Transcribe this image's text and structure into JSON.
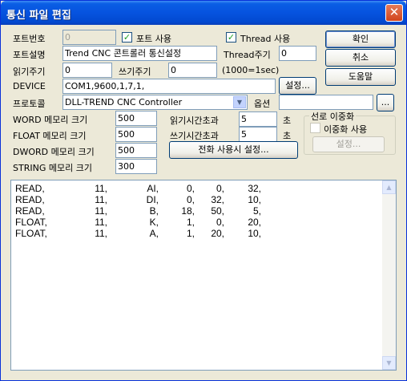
{
  "window": {
    "title": "통신 파일 편집",
    "close_glyph": "✕"
  },
  "form": {
    "port_no": {
      "label": "포트번호",
      "value": "0"
    },
    "port_use": {
      "label": "포트 사용",
      "checked": true
    },
    "thread_use": {
      "label": "Thread 사용",
      "checked": true
    },
    "port_desc": {
      "label": "포트설명",
      "value": "Trend CNC 콘트롤러 통신설정"
    },
    "thread_period": {
      "label": "Thread주기",
      "value": "0"
    },
    "read_period": {
      "label": "읽기주기",
      "value": "0"
    },
    "write_period": {
      "label": "쓰기주기",
      "value": "0"
    },
    "period_unit": "(1000=1sec)",
    "device": {
      "label": "DEVICE",
      "value": "COM1,9600,1,7,1,",
      "button": "설정..."
    },
    "protocol": {
      "label": "프로토콜",
      "value": "DLL-TREND CNC Controller",
      "option_label": "옵션",
      "option_value": "",
      "ellipsis_button": "..."
    },
    "word_mem": {
      "label": "WORD 메모리 크기",
      "value": "500"
    },
    "float_mem": {
      "label": "FLOAT 메모리 크기",
      "value": "500"
    },
    "dword_mem": {
      "label": "DWORD 메모리 크기",
      "value": "500"
    },
    "string_mem": {
      "label": "STRING 메모리 크기",
      "value": "300"
    },
    "read_timeout": {
      "label": "읽기시간초과",
      "value": "5",
      "unit": "초"
    },
    "write_timeout": {
      "label": "쓰기시간초과",
      "value": "5",
      "unit": "초"
    },
    "phone_button": "전화 사용시 설정...",
    "redundancy": {
      "group_title": "선로 이중화",
      "checkbox_label": "이중화 사용",
      "checked": false,
      "button": "설정..."
    }
  },
  "buttons": {
    "ok": "확인",
    "cancel": "취소",
    "help": "도움말"
  },
  "memo_lines": [
    [
      "READ,",
      "11,",
      "AI,",
      "0,",
      "0,",
      "32,"
    ],
    [
      "READ,",
      "11,",
      "DI,",
      "0,",
      "32,",
      "10,"
    ],
    [
      "READ,",
      "11,",
      "B,",
      "18,",
      "50,",
      "5,"
    ],
    [
      "FLOAT,",
      "11,",
      "K,",
      "1,",
      "0,",
      "20,"
    ],
    [
      "FLOAT,",
      "11,",
      "A,",
      "1,",
      "20,",
      "10,"
    ]
  ],
  "colors": {
    "title_bar": "#0653df",
    "dialog_bg": "#ece9d8",
    "check_mark": "#21a121"
  }
}
